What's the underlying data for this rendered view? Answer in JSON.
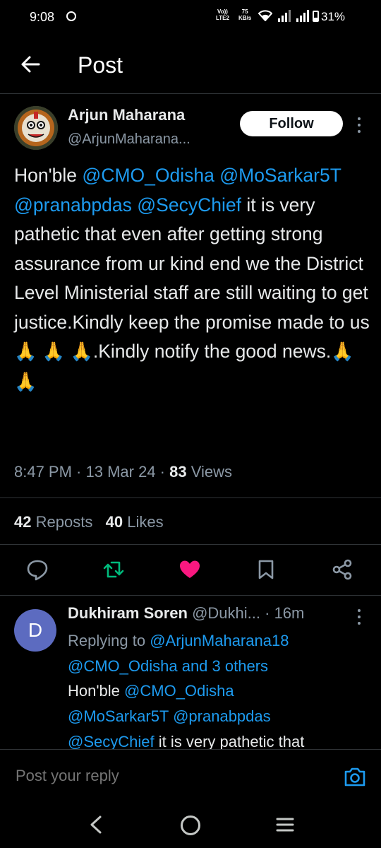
{
  "status_bar": {
    "time": "9:08",
    "network_top": "Vo))",
    "network_bottom": "LTE2",
    "speed_top": "75",
    "speed_bottom": "KB/s",
    "battery": "31%"
  },
  "header": {
    "title": "Post"
  },
  "post": {
    "author_name": "Arjun Maharana",
    "author_handle": "@ArjunMaharana...",
    "follow_label": "Follow",
    "text_segments": {
      "s1": "Hon'ble ",
      "m1": "@CMO_Odisha",
      "m2": "@MoSarkar5T",
      "m3": "@pranabpdas",
      "m4": "@SecyChief",
      "s2": "  it is very pathetic that even after getting strong assurance from ur kind end we the District Level Ministerial staff are still waiting to get justice.Kindly keep the promise made to us",
      "e1": "🙏",
      "e2": "🙏",
      "e3": "🙏",
      "s3": ".Kindly notify the good news.",
      "e4": "🙏",
      "e5": "🙏"
    },
    "time": "8:47 PM",
    "date": "13 Mar 24",
    "views_count": "83",
    "views_label": "Views",
    "reposts_count": "42",
    "reposts_label": "Reposts",
    "likes_count": "40",
    "likes_label": "Likes"
  },
  "reply": {
    "avatar_letter": "D",
    "name": "Dukhiram Soren",
    "handle": "@Dukhi...",
    "time": "16m",
    "replying_prefix": "Replying to",
    "replying_to": "@ArjunMaharana18",
    "replying_others": "@CMO_Odisha and 3 others",
    "text_start": "Hon'ble ",
    "m1": "@CMO_Odisha",
    "m2": "@MoSarkar5T",
    "m3": "@pranabpdas",
    "m4": "@SecyChief",
    "text_rest": "  it is very pathetic that"
  },
  "composer": {
    "placeholder": "Post your reply"
  },
  "icons": {
    "back": "arrow-left-icon",
    "reply": "comment-icon",
    "repost": "repost-icon",
    "like": "heart-icon",
    "bookmark": "bookmark-icon",
    "share": "share-icon",
    "camera": "camera-icon"
  },
  "colors": {
    "background": "#000000",
    "link": "#1d9bf0",
    "repost_active": "#00ba7c",
    "like_active": "#f91880",
    "reply_avatar": "#5c6bc0"
  }
}
